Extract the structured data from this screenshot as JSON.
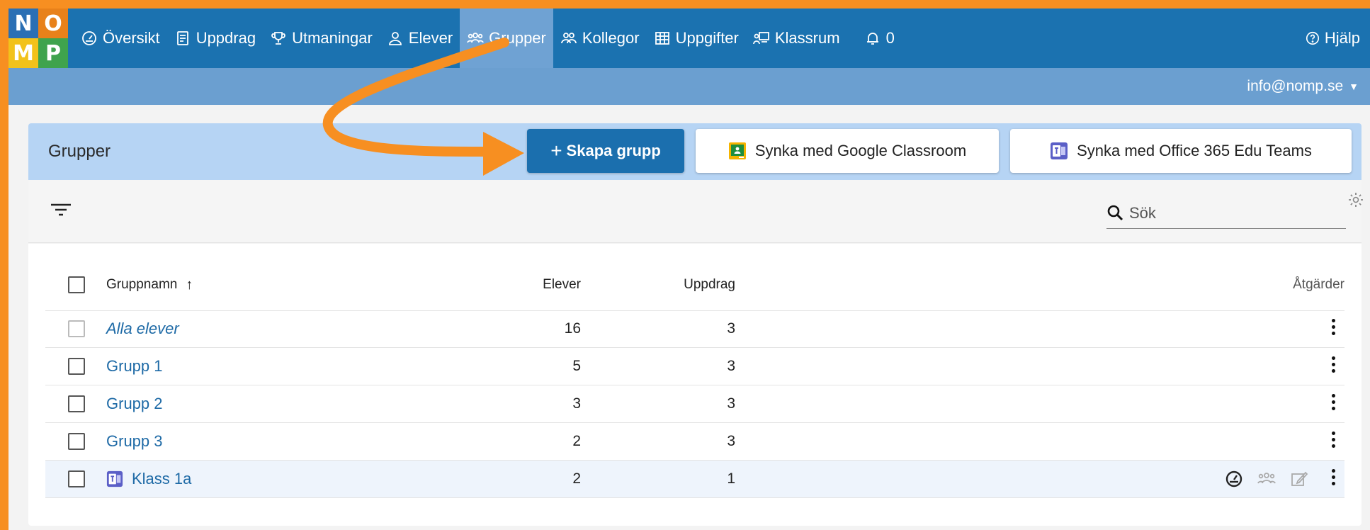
{
  "logo": {
    "letters": [
      "N",
      "O",
      "M",
      "P"
    ]
  },
  "nav": {
    "items": [
      {
        "label": "Översikt",
        "icon": "gauge-icon"
      },
      {
        "label": "Uppdrag",
        "icon": "book-icon"
      },
      {
        "label": "Utmaningar",
        "icon": "trophy-icon"
      },
      {
        "label": "Elever",
        "icon": "person-icon"
      },
      {
        "label": "Grupper",
        "icon": "group-icon",
        "active": true
      },
      {
        "label": "Kollegor",
        "icon": "colleagues-icon"
      },
      {
        "label": "Uppgifter",
        "icon": "grid-icon"
      },
      {
        "label": "Klassrum",
        "icon": "classroom-icon"
      },
      {
        "label": "0",
        "icon": "bell-icon"
      }
    ],
    "help": "Hjälp"
  },
  "user": {
    "email": "info@nomp.se"
  },
  "page": {
    "title": "Grupper",
    "create_button": "Skapa grupp",
    "create_plus": "+",
    "google_button": "Synka med Google Classroom",
    "office_button": "Synka med Office 365 Edu Teams"
  },
  "search": {
    "placeholder": "Sök"
  },
  "table": {
    "headers": {
      "name": "Gruppnamn",
      "sort_arrow": "↑",
      "students": "Elever",
      "assignments": "Uppdrag",
      "actions": "Åtgärder"
    },
    "rows": [
      {
        "name": "Alla elever",
        "students": "16",
        "assignments": "3"
      },
      {
        "name": "Grupp 1",
        "students": "5",
        "assignments": "3"
      },
      {
        "name": "Grupp 2",
        "students": "3",
        "assignments": "3"
      },
      {
        "name": "Grupp 3",
        "students": "2",
        "assignments": "3"
      },
      {
        "name": "Klass 1a",
        "students": "2",
        "assignments": "1"
      }
    ]
  },
  "colors": {
    "topbar": "#1b72b0",
    "active_tab": "#6fa2d3",
    "primary": "#1b6fae",
    "annotation_arrow": "#f78f21"
  }
}
